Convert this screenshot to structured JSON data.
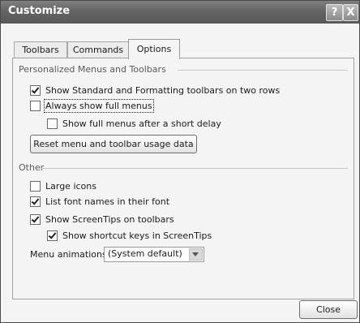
{
  "window": {
    "title": "Customize",
    "help_glyph": "?",
    "close_glyph": "X"
  },
  "tabs": [
    {
      "label": "Toolbars",
      "active": false
    },
    {
      "label": "Commands",
      "active": false
    },
    {
      "label": "Options",
      "active": true
    }
  ],
  "personalized": {
    "heading": "Personalized Menus and Toolbars",
    "options": [
      {
        "label": "Show Standard and Formatting toolbars on two rows",
        "checked": true
      },
      {
        "label": "Always show full menus",
        "checked": false
      },
      {
        "label": "Show full menus after a short delay",
        "checked": false
      }
    ],
    "reset_label": "Reset menu and toolbar usage data"
  },
  "other": {
    "heading": "Other",
    "options": [
      {
        "label": "Large icons",
        "checked": false
      },
      {
        "label": "List font names in their font",
        "checked": true
      },
      {
        "label": "Show ScreenTips on toolbars",
        "checked": true
      },
      {
        "label": "Show shortcut keys in ScreenTips",
        "checked": true
      }
    ],
    "animations_label": "Menu animations:",
    "animations_value": "(System default)"
  },
  "footer": {
    "close_label": "Close"
  }
}
